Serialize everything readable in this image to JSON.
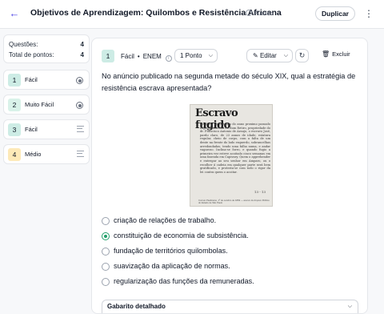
{
  "header": {
    "title": "Objetivos de Aprendizagem: Quilombos e Resistência Africana",
    "visibility": "Público",
    "duplicate_label": "Duplicar"
  },
  "summary": {
    "questions_label": "Questões:",
    "questions_value": "4",
    "points_label": "Total de pontos:",
    "points_value": "4"
  },
  "question_list": [
    {
      "number": "1",
      "label": "Fácil",
      "icon": "radio-icon",
      "color": "#cdece5"
    },
    {
      "number": "2",
      "label": "Muito Fácil",
      "icon": "radio-icon",
      "color": "#d9f2e9"
    },
    {
      "number": "3",
      "label": "Fácil",
      "icon": "list-lines-icon",
      "color": "#cdece5"
    },
    {
      "number": "4",
      "label": "Médio",
      "icon": "list-lines-icon",
      "color": "#fde9b8"
    }
  ],
  "card": {
    "number": "1",
    "difficulty": "Fácil",
    "dot": "•",
    "source": "ENEM",
    "points": "1 Ponto",
    "edit_label": "Editar",
    "delete_label": "Excluir",
    "question": "No anúncio publicado na segunda metade do século XIX, qual a estratégia de resistência escrava apresentada?",
    "figure": {
      "title": "Escravo fugido",
      "text": "No dia 8 de Outubro do anno proximo passado fugio da fazenda do Bom Retiro, propriedade do dr. Francisco Antonio de Araujo, o escravo José, pardo claro, de 23 annos de idade, estatura regular, cheio de corpo, com a falta de um dente na frente do lado esquerdo, sobrancelhas arredondadas, tendo uma falha numa, e andar vagaroso. Inclina-se forro, e quando fugio a primeira vez esteve acoitado cinco semanas em uma fazenda em Capivary. Quem o apprehender e entregar ao seu senhor em Amparo, ou o recolher á cadeia em qualquer parte será bem gratificado, e protesta-se com todo o rigor da lei contra quem o acoitar.",
      "number": "13 - 13",
      "caption": "Correio Paulistano, 1º de outubro de 1869 — acervo do Arquivo Público do Estado de São Paulo"
    },
    "options": [
      {
        "text": "criação de relações de trabalho.",
        "selected": false
      },
      {
        "text": "constituição de economia de subsistência.",
        "selected": true
      },
      {
        "text": "fundação de territórios quilombolas.",
        "selected": false
      },
      {
        "text": "suavização da aplicação de normas.",
        "selected": false
      },
      {
        "text": "regularização das funções da remuneradas.",
        "selected": false
      }
    ],
    "answer_label": "Gabarito detalhado"
  },
  "colors": {
    "accent": "#4f46e5",
    "selected": "#22a06b"
  }
}
